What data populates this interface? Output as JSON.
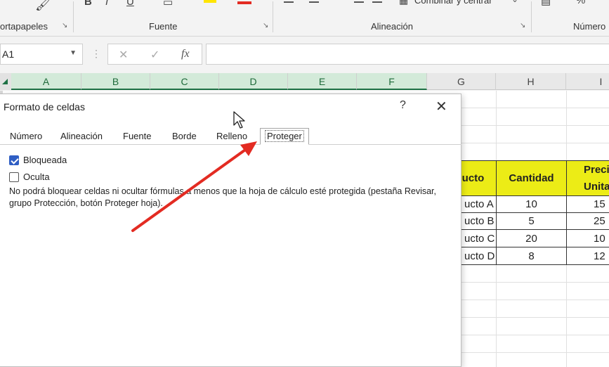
{
  "ribbon": {
    "groups": [
      {
        "label": "ortapapeles"
      },
      {
        "label": "Fuente"
      },
      {
        "label": "Alineación"
      },
      {
        "label": "Número"
      }
    ],
    "merge_label": "Combinar y centrar"
  },
  "formula_bar": {
    "name_box": "A1",
    "cancel_symbol": "✕",
    "enter_symbol": "✓",
    "fx_label": "fx",
    "formula_value": ""
  },
  "columns": [
    "A",
    "B",
    "C",
    "D",
    "E",
    "F",
    "G",
    "H",
    "I"
  ],
  "table": {
    "headers": [
      "ucto",
      "Cantidad",
      "Preci",
      "Unitar"
    ],
    "rows": [
      [
        "ucto A",
        "10",
        "15"
      ],
      [
        "ucto B",
        "5",
        "25"
      ],
      [
        "ucto C",
        "20",
        "10"
      ],
      [
        "ucto D",
        "8",
        "12"
      ]
    ]
  },
  "dialog": {
    "title": "Formato de celdas",
    "help": "?",
    "close": "✕",
    "tabs": [
      "Número",
      "Alineación",
      "Fuente",
      "Borde",
      "Relleno",
      "Proteger"
    ],
    "active_tab": "Proteger",
    "checkboxes": [
      {
        "label": "Bloqueada",
        "checked": true
      },
      {
        "label": "Oculta",
        "checked": false
      }
    ],
    "note": "No podrá bloquear celdas ni ocultar fórmulas a menos que la hoja de cálculo esté protegida (pestaña Revisar, grupo Protección, botón Proteger hoja)."
  },
  "colors": {
    "accent_green": "#1e7145",
    "header_yellow": "#ecec16",
    "annotation_red": "#e32b22",
    "checkbox_blue": "#2f5ec4"
  },
  "icons": [
    "paste-brush-icon",
    "bold-icon",
    "italic-icon",
    "underline-icon",
    "borders-icon",
    "fill-color-icon",
    "font-color-icon",
    "align-icon",
    "merge-icon",
    "number-format-icon",
    "percent-icon",
    "fx-icon",
    "mouse-cursor-icon",
    "red-arrow-annotation"
  ]
}
